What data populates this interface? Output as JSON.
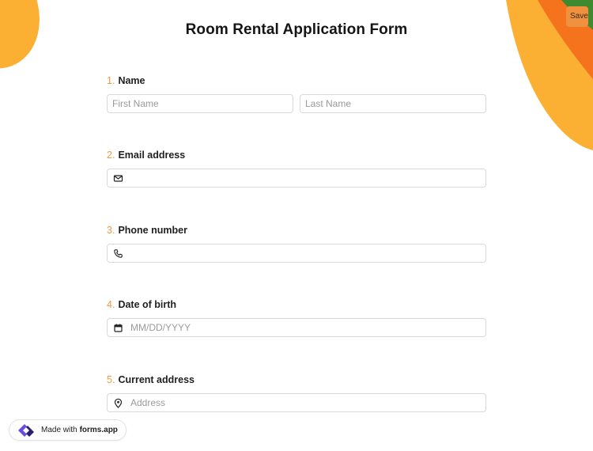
{
  "header": {
    "title": "Room Rental Application Form",
    "save_label": "Save"
  },
  "questions": [
    {
      "number": "1.",
      "label": "Name",
      "fields": [
        {
          "placeholder": "First Name",
          "value": ""
        },
        {
          "placeholder": "Last Name",
          "value": ""
        }
      ]
    },
    {
      "number": "2.",
      "label": "Email address",
      "icon": "envelope-icon",
      "placeholder": "",
      "value": ""
    },
    {
      "number": "3.",
      "label": "Phone number",
      "icon": "phone-icon",
      "placeholder": "",
      "value": ""
    },
    {
      "number": "4.",
      "label": "Date of birth",
      "icon": "calendar-icon",
      "placeholder": "MM/DD/YYYY",
      "value": ""
    },
    {
      "number": "5.",
      "label": "Current address",
      "icon": "location-pin-icon",
      "placeholder": "Address",
      "value": ""
    }
  ],
  "footer": {
    "made_with": "Made with",
    "brand": "forms.app"
  },
  "colors": {
    "accent_orange": "#f39a3d",
    "deco_yellow": "#fbb033",
    "deco_orange": "#f4731c",
    "deco_green": "#3f8a2e",
    "save_button": "#f0913f",
    "logo_purple": "#6a4ce0"
  }
}
